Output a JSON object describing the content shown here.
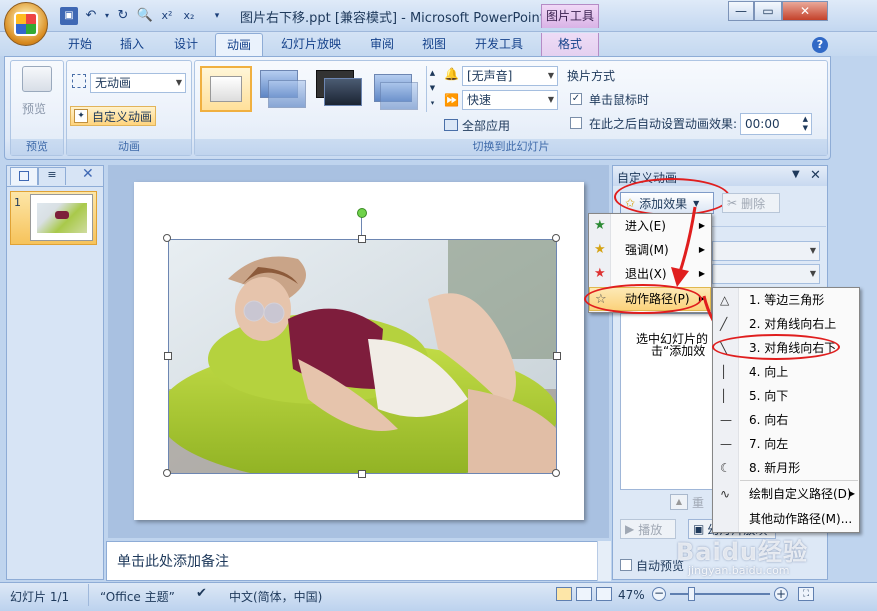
{
  "window": {
    "doc_title": "图片右下移.ppt [兼容模式] - Microsoft PowerPoint",
    "contextual_tab": "图片工具"
  },
  "tabs": [
    "开始",
    "插入",
    "设计",
    "动画",
    "幻灯片放映",
    "审阅",
    "视图",
    "开发工具",
    "格式"
  ],
  "ribbon": {
    "preview": {
      "button": "预览",
      "group": "预览"
    },
    "animation": {
      "dropdown": "无动画",
      "custom_button": "自定义动画",
      "group": "动画"
    },
    "transition": {
      "sound": "[无声音]",
      "speed": "快速",
      "apply_all": "全部应用",
      "advance_title": "换片方式",
      "on_click": "单击鼠标时",
      "auto_after": "在此之后自动设置动画效果:",
      "time": "00:00",
      "group": "切换到此幻灯片"
    }
  },
  "left_panel": {
    "slide_number": "1"
  },
  "notes": {
    "placeholder": "单击此处添加备注"
  },
  "custom_pane": {
    "title": "自定义动画",
    "add_effect": "添加效果",
    "remove": "删除",
    "hint_line1": "选中幻灯片的",
    "hint_line2": "击“添加效",
    "reorder": "重",
    "play": "播放",
    "slideshow": "幻灯片放映",
    "auto_preview": "自动预览"
  },
  "effect_menu": {
    "items": [
      "进入(E)",
      "强调(M)",
      "退出(X)",
      "动作路径(P)"
    ]
  },
  "path_menu": {
    "items": [
      "1. 等边三角形",
      "2. 对角线向右上",
      "3. 对角线向右下",
      "4. 向上",
      "5. 向下",
      "6. 向右",
      "7. 向左",
      "8. 新月形",
      "绘制自定义路径(D)",
      "其他动作路径(M)..."
    ]
  },
  "status": {
    "slide": "幻灯片 1/1",
    "theme": "“Office 主题”",
    "language": "中文(简体，中国)",
    "zoom": "47%"
  },
  "watermark": {
    "brand": "Baidu经验",
    "url": "jingyan.baidu.com"
  },
  "colors": {
    "highlight_ellipse": "#e01e1e",
    "ribbon_bg": "#dfe9f7",
    "menu_highlight": "#fbd27c"
  }
}
